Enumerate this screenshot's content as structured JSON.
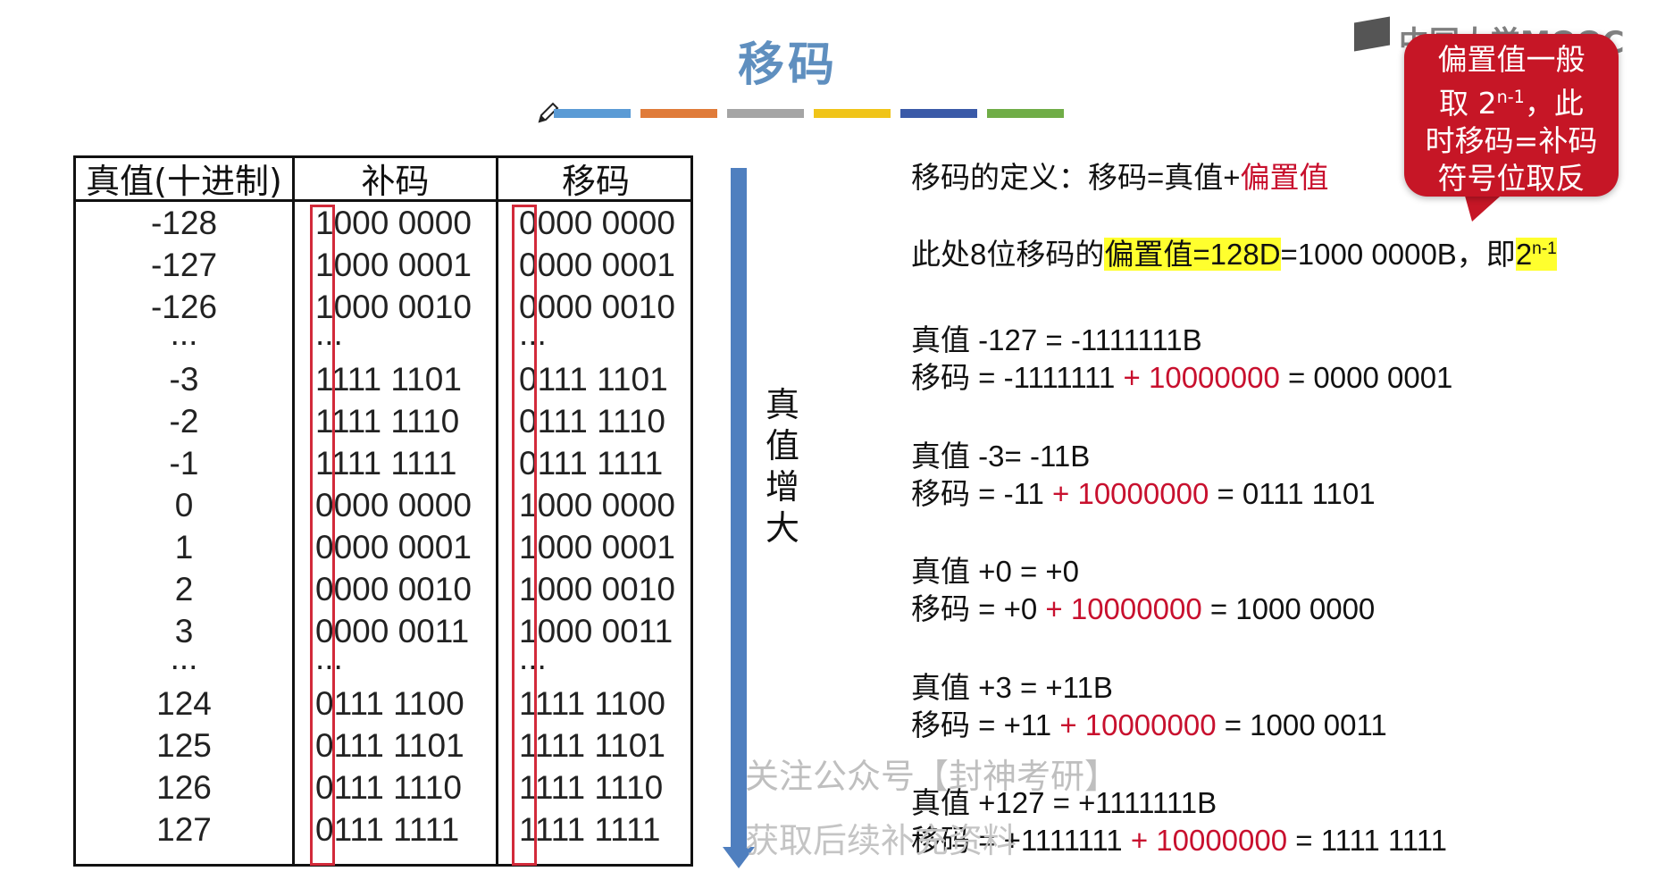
{
  "title": "移码",
  "color_bars": [
    "#5b9bd5",
    "#e07b39",
    "#a5a5a5",
    "#f0c419",
    "#3a5aa8",
    "#70ad47"
  ],
  "table": {
    "headers": [
      "真值(十进制)",
      "补码",
      "移码"
    ],
    "rows": [
      [
        "-128",
        "1000 0000",
        "0000 0000"
      ],
      [
        "-127",
        "1000 0001",
        "0000 0001"
      ],
      [
        "-126",
        "1000 0010",
        "0000 0010"
      ],
      [
        "...",
        "...",
        "..."
      ],
      [
        "-3",
        "1111 1101",
        "0111 1101"
      ],
      [
        "-2",
        "1111 1110",
        "0111 1110"
      ],
      [
        "-1",
        "1111 1111",
        "0111 1111"
      ],
      [
        "0",
        "0000 0000",
        "1000 0000"
      ],
      [
        "1",
        "0000 0001",
        "1000 0001"
      ],
      [
        "2",
        "0000 0010",
        "1000 0010"
      ],
      [
        "3",
        "0000 0011",
        "1000 0011"
      ],
      [
        "...",
        "...",
        "..."
      ],
      [
        "124",
        "0111 1100",
        "1111 1100"
      ],
      [
        "125",
        "0111 1101",
        "1111 1101"
      ],
      [
        "126",
        "0111 1110",
        "1111 1110"
      ],
      [
        "127",
        "0111 1111",
        "1111 1111"
      ]
    ]
  },
  "arrow_label": [
    "真",
    "值",
    "增",
    "大"
  ],
  "definition": {
    "prefix": "移码的定义：移码=真值+",
    "bias": "偏置值"
  },
  "bias_note": {
    "prefix": "此处8位移码的",
    "highlight": "偏置值=128D",
    "mid": "=1000 0000B，即",
    "base": "2",
    "exp": "n-1"
  },
  "examples": [
    {
      "true_line": "真值 -127 = -1111111B",
      "p1": "移码 = -1111111 ",
      "plus": "+ 10000000",
      "p2": " = 0000 0001"
    },
    {
      "true_line": "真值 -3= -11B",
      "p1": "移码 = -11 ",
      "plus": "+ 10000000",
      "p2": " = 0111 1101"
    },
    {
      "true_line": "真值 +0 = +0",
      "p1": "移码 = +0 ",
      "plus": "+ 10000000",
      "p2": " = 1000 0000"
    },
    {
      "true_line": "真值 +3 = +11B",
      "p1": "移码 = +11 ",
      "plus": "+ 10000000",
      "p2": " = 1000 0011"
    },
    {
      "true_line": "真值 +127 = +1111111B",
      "p1": "移码 = +1111111 ",
      "plus": "+ 10000000",
      "p2": " = 1111 1111"
    }
  ],
  "callout": {
    "line1": "偏置值一般",
    "line2a": "取 2",
    "line2_exp": "n-1",
    "line2b": "，此",
    "line3": "时移码=补码",
    "line4": "符号位取反"
  },
  "logo": "中国大学MOOC",
  "watermark": {
    "line1": "关注公众号【封神考研】",
    "line2": "获取后续补充资料"
  }
}
